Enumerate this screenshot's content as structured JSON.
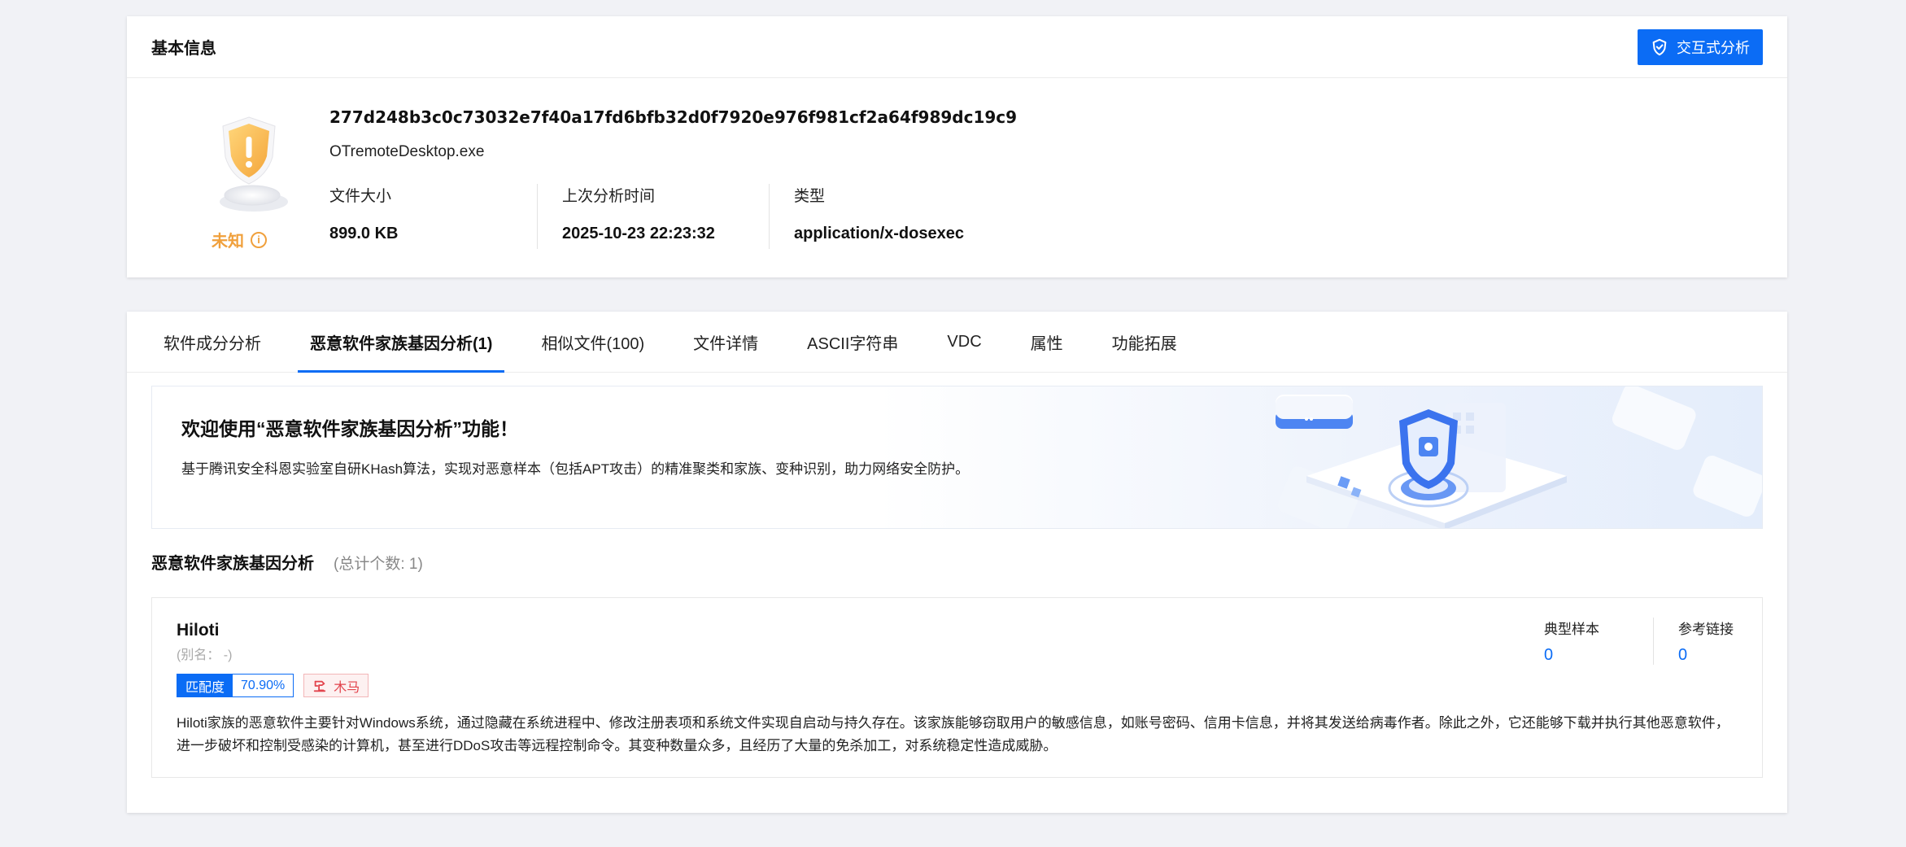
{
  "basic_info": {
    "title": "基本信息",
    "interactive_button": "交互式分析",
    "verdict": "未知",
    "hash": "277d248b3c0c73032e7f40a17fd6bfb32d0f7920e976f981cf2a64f989dc19c9",
    "filename": "OTremoteDesktop.exe",
    "meta": [
      {
        "label": "文件大小",
        "value": "899.0 KB"
      },
      {
        "label": "上次分析时间",
        "value": "2025-10-23 22:23:32"
      },
      {
        "label": "类型",
        "value": "application/x-dosexec"
      }
    ]
  },
  "tabs": [
    {
      "label": "软件成分分析",
      "active": false
    },
    {
      "label": "恶意软件家族基因分析(1)",
      "active": true
    },
    {
      "label": "相似文件(100)",
      "active": false
    },
    {
      "label": "文件详情",
      "active": false
    },
    {
      "label": "ASCII字符串",
      "active": false
    },
    {
      "label": "VDC",
      "active": false
    },
    {
      "label": "属性",
      "active": false
    },
    {
      "label": "功能拓展",
      "active": false
    }
  ],
  "banner": {
    "title": "欢迎使用“恶意软件家族基因分析”功能！",
    "description": "基于腾讯安全科恩实验室自研KHash算法，实现对恶意样本（包括APT攻击）的精准聚类和家族、变种识别，助力网络安全防护。"
  },
  "section": {
    "title": "恶意软件家族基因分析",
    "count": "(总计个数: 1)"
  },
  "family": {
    "name": "Hiloti",
    "alias": "(别名：  -)",
    "match_label": "匹配度",
    "match_value": "70.90%",
    "type_tag": "木马",
    "description": "Hiloti家族的恶意软件主要针对Windows系统，通过隐藏在系统进程中、修改注册表项和系统文件实现自启动与持久存在。该家族能够窃取用户的敏感信息，如账号密码、信用卡信息，并将其发送给病毒作者。除此之外，它还能够下载并执行其他恶意软件，进一步破坏和控制受感染的计算机，甚至进行DDoS攻击等远程控制命令。其变种数量众多，且经历了大量的免杀加工，对系统稳定性造成威胁。",
    "stats": [
      {
        "label": "典型样本",
        "value": "0"
      },
      {
        "label": "参考链接",
        "value": "0"
      }
    ]
  },
  "colors": {
    "accent": "#0b6cf5",
    "unknown": "#f0a03c",
    "trojan": "#e2434c"
  }
}
